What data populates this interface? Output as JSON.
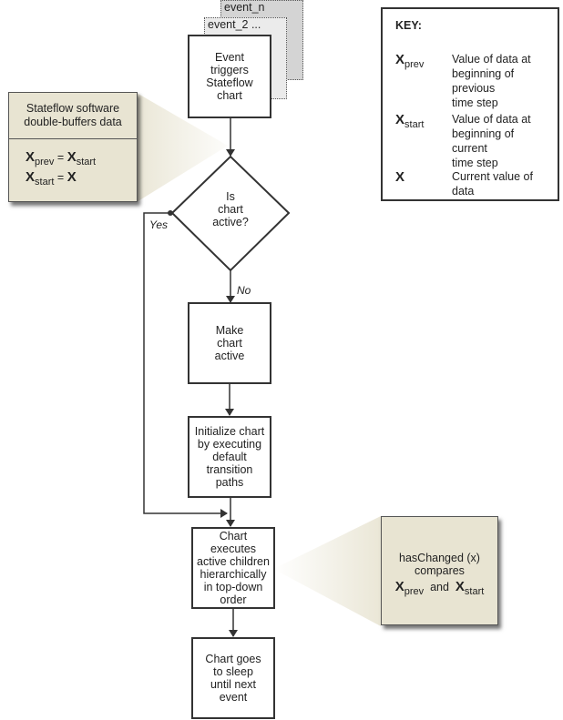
{
  "event_cards": {
    "back": "event_n",
    "middle": "event_2 ..."
  },
  "nodes": {
    "event_trigger": "Event\ntriggers\nStateflow\nchart",
    "decision": "Is\nchart\nactive?",
    "make_active": "Make\nchart\nactive",
    "initialize": "Initialize chart\nby executing\ndefault\ntransition\npaths",
    "execute": "Chart\nexecutes\nactive children\nhierarchically\nin top-down\norder",
    "sleep": "Chart goes\nto sleep\nuntil next\nevent"
  },
  "edge_labels": {
    "yes": "Yes",
    "no": "No"
  },
  "callout_buffer": {
    "title": "Stateflow software\ndouble-buffers data",
    "eq1": {
      "lhs": "X",
      "lhs_sub": "prev",
      "op": "=",
      "rhs": "X",
      "rhs_sub": "start"
    },
    "eq2": {
      "lhs": "X",
      "lhs_sub": "start",
      "op": "=",
      "rhs": "X",
      "rhs_sub": ""
    }
  },
  "callout_haschanged": {
    "line1": "hasChanged (x)",
    "line2": "compares",
    "a": "X",
    "a_sub": "prev",
    "and": "and",
    "b": "X",
    "b_sub": "start"
  },
  "key": {
    "title": "KEY:",
    "items": [
      {
        "sym": "X",
        "sub": "prev",
        "desc": "Value of data at\nbeginning of previous\ntime step"
      },
      {
        "sym": "X",
        "sub": "start",
        "desc": "Value of data at\nbeginning of current\ntime step"
      },
      {
        "sym": "X",
        "sub": "",
        "desc": "Current value of data"
      }
    ]
  },
  "colors": {
    "callout_fill": "#e8e4d2",
    "card_back": "#d4d4d4",
    "card_middle": "#ebebeb",
    "line": "#333333"
  }
}
